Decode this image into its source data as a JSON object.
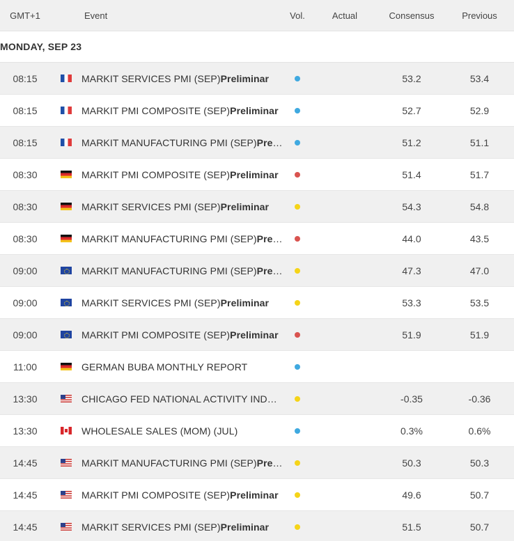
{
  "header": {
    "timezone": "GMT+1",
    "event": "Event",
    "vol": "Vol.",
    "actual": "Actual",
    "consensus": "Consensus",
    "previous": "Previous"
  },
  "day_label": "MONDAY, SEP 23",
  "colors": {
    "low": "#3fa9e0",
    "medium": "#f5d418",
    "high": "#d9534f"
  },
  "rows": [
    {
      "time": "08:15",
      "flag": "fr",
      "event": "MARKIT SERVICES PMI (SEP)",
      "suffix": "Preliminar",
      "vol": "low",
      "actual": "",
      "consensus": "53.2",
      "previous": "53.4"
    },
    {
      "time": "08:15",
      "flag": "fr",
      "event": "MARKIT PMI COMPOSITE (SEP)",
      "suffix": "Preliminar",
      "vol": "low",
      "actual": "",
      "consensus": "52.7",
      "previous": "52.9"
    },
    {
      "time": "08:15",
      "flag": "fr",
      "event": "MARKIT MANUFACTURING PMI (SEP)",
      "suffix": "Preliminar",
      "vol": "low",
      "actual": "",
      "consensus": "51.2",
      "previous": "51.1"
    },
    {
      "time": "08:30",
      "flag": "de",
      "event": "MARKIT PMI COMPOSITE (SEP)",
      "suffix": "Preliminar",
      "vol": "high",
      "actual": "",
      "consensus": "51.4",
      "previous": "51.7"
    },
    {
      "time": "08:30",
      "flag": "de",
      "event": "MARKIT SERVICES PMI (SEP)",
      "suffix": "Preliminar",
      "vol": "medium",
      "actual": "",
      "consensus": "54.3",
      "previous": "54.8"
    },
    {
      "time": "08:30",
      "flag": "de",
      "event": "MARKIT MANUFACTURING PMI (SEP)",
      "suffix": "Preliminar",
      "vol": "high",
      "actual": "",
      "consensus": "44.0",
      "previous": "43.5"
    },
    {
      "time": "09:00",
      "flag": "eu",
      "event": "MARKIT MANUFACTURING PMI (SEP)",
      "suffix": "Preliminar",
      "vol": "medium",
      "actual": "",
      "consensus": "47.3",
      "previous": "47.0"
    },
    {
      "time": "09:00",
      "flag": "eu",
      "event": "MARKIT SERVICES PMI (SEP)",
      "suffix": "Preliminar",
      "vol": "medium",
      "actual": "",
      "consensus": "53.3",
      "previous": "53.5"
    },
    {
      "time": "09:00",
      "flag": "eu",
      "event": "MARKIT PMI COMPOSITE (SEP)",
      "suffix": "Preliminar",
      "vol": "high",
      "actual": "",
      "consensus": "51.9",
      "previous": "51.9"
    },
    {
      "time": "11:00",
      "flag": "de",
      "event": "GERMAN BUBA MONTHLY REPORT",
      "suffix": "",
      "vol": "low",
      "actual": "",
      "consensus": "",
      "previous": ""
    },
    {
      "time": "13:30",
      "flag": "us",
      "event": "CHICAGO FED NATIONAL ACTIVITY INDEX (AUG)",
      "suffix": "",
      "vol": "medium",
      "actual": "",
      "consensus": "-0.35",
      "previous": "-0.36"
    },
    {
      "time": "13:30",
      "flag": "ca",
      "event": "WHOLESALE SALES (MOM) (JUL)",
      "suffix": "",
      "vol": "low",
      "actual": "",
      "consensus": "0.3%",
      "previous": "0.6%"
    },
    {
      "time": "14:45",
      "flag": "us",
      "event": "MARKIT MANUFACTURING PMI (SEP)",
      "suffix": "Preliminar",
      "vol": "medium",
      "actual": "",
      "consensus": "50.3",
      "previous": "50.3"
    },
    {
      "time": "14:45",
      "flag": "us",
      "event": "MARKIT PMI COMPOSITE (SEP)",
      "suffix": "Preliminar",
      "vol": "medium",
      "actual": "",
      "consensus": "49.6",
      "previous": "50.7"
    },
    {
      "time": "14:45",
      "flag": "us",
      "event": "MARKIT SERVICES PMI (SEP)",
      "suffix": "Preliminar",
      "vol": "medium",
      "actual": "",
      "consensus": "51.5",
      "previous": "50.7"
    }
  ]
}
